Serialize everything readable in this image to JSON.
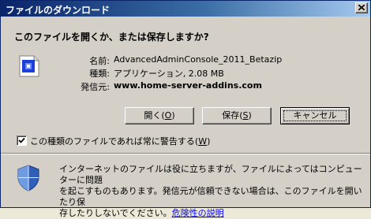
{
  "window": {
    "title": "ファイルのダウンロード"
  },
  "question": "このファイルを開くか、または保存しますか?",
  "file_info": {
    "name_label": "名前:",
    "name_value": "AdvancedAdminConsole_2011_Betazip",
    "type_label": "種類:",
    "type_value": "アプリケーション, 2.08 MB",
    "from_label": "発信元:",
    "from_value": "www.home-server-addins.com"
  },
  "buttons": {
    "open_prefix": "開く(",
    "open_key": "O",
    "open_suffix": ")",
    "save_prefix": "保存(",
    "save_key": "S",
    "save_suffix": ")",
    "cancel_label": "キャンセル"
  },
  "checkbox": {
    "checked": true,
    "label_prefix": "この種類のファイルであれば常に警告する(",
    "label_key": "W",
    "label_suffix": ")"
  },
  "warning": {
    "line1": "インターネットのファイルは役に立ちますが、ファイルによってはコンピューターに問題",
    "line2": "を起こすものもあります。発信元が信頼できない場合は、このファイルを開いたり保",
    "line3_text": "存したりしないでください。",
    "help_link": "危険性の説明"
  },
  "icons": {
    "close": "close-icon",
    "file": "file-type-icon",
    "shield": "security-shield-icon"
  },
  "colors": {
    "title_bar_start": "#0a246a",
    "title_bar_end": "#a6caf0",
    "dialog_background": "#d4d0c8",
    "link": "#0000ff"
  }
}
